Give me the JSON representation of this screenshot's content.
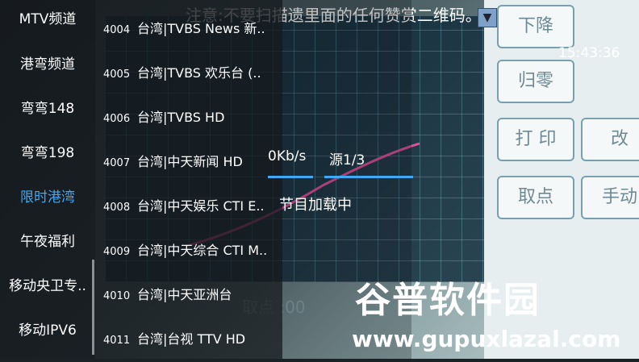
{
  "overlay_top_text": "注意:不要扫描遗里面的任何赞赏二维码。",
  "clock": "15:43:36",
  "categories": [
    {
      "label": "MTV频道"
    },
    {
      "label": "港弯频道"
    },
    {
      "label": "弯弯148"
    },
    {
      "label": "弯弯198"
    },
    {
      "label": "限时港湾"
    },
    {
      "label": "午夜福利"
    },
    {
      "label": "移动央卫专.."
    },
    {
      "label": "移动IPV6"
    }
  ],
  "channels": [
    {
      "num": "4004",
      "name": "台湾|TVBS News 新.."
    },
    {
      "num": "4005",
      "name": "台湾|TVBS 欢乐台 (.."
    },
    {
      "num": "4006",
      "name": "台湾|TVBS HD"
    },
    {
      "num": "4007",
      "name": "台湾|中天新闻 HD"
    },
    {
      "num": "4008",
      "name": "台湾|中天娱乐 CTI E.."
    },
    {
      "num": "4009",
      "name": "台湾|中天综合 CTI M.."
    },
    {
      "num": "4010",
      "name": "台湾|中天亚洲台"
    },
    {
      "num": "4011",
      "name": "台湾|台视 TTV HD"
    }
  ],
  "player": {
    "speed": "0Kb/s",
    "source": "源1/3",
    "status": "节目加载中"
  },
  "panel_buttons": [
    "下降",
    "归零",
    "打 印",
    "取点",
    "改",
    "手动"
  ],
  "watermark": {
    "cn": "谷普软件园",
    "url": "www.gupuxlazal.com"
  },
  "bottom_text": "取点 :00"
}
